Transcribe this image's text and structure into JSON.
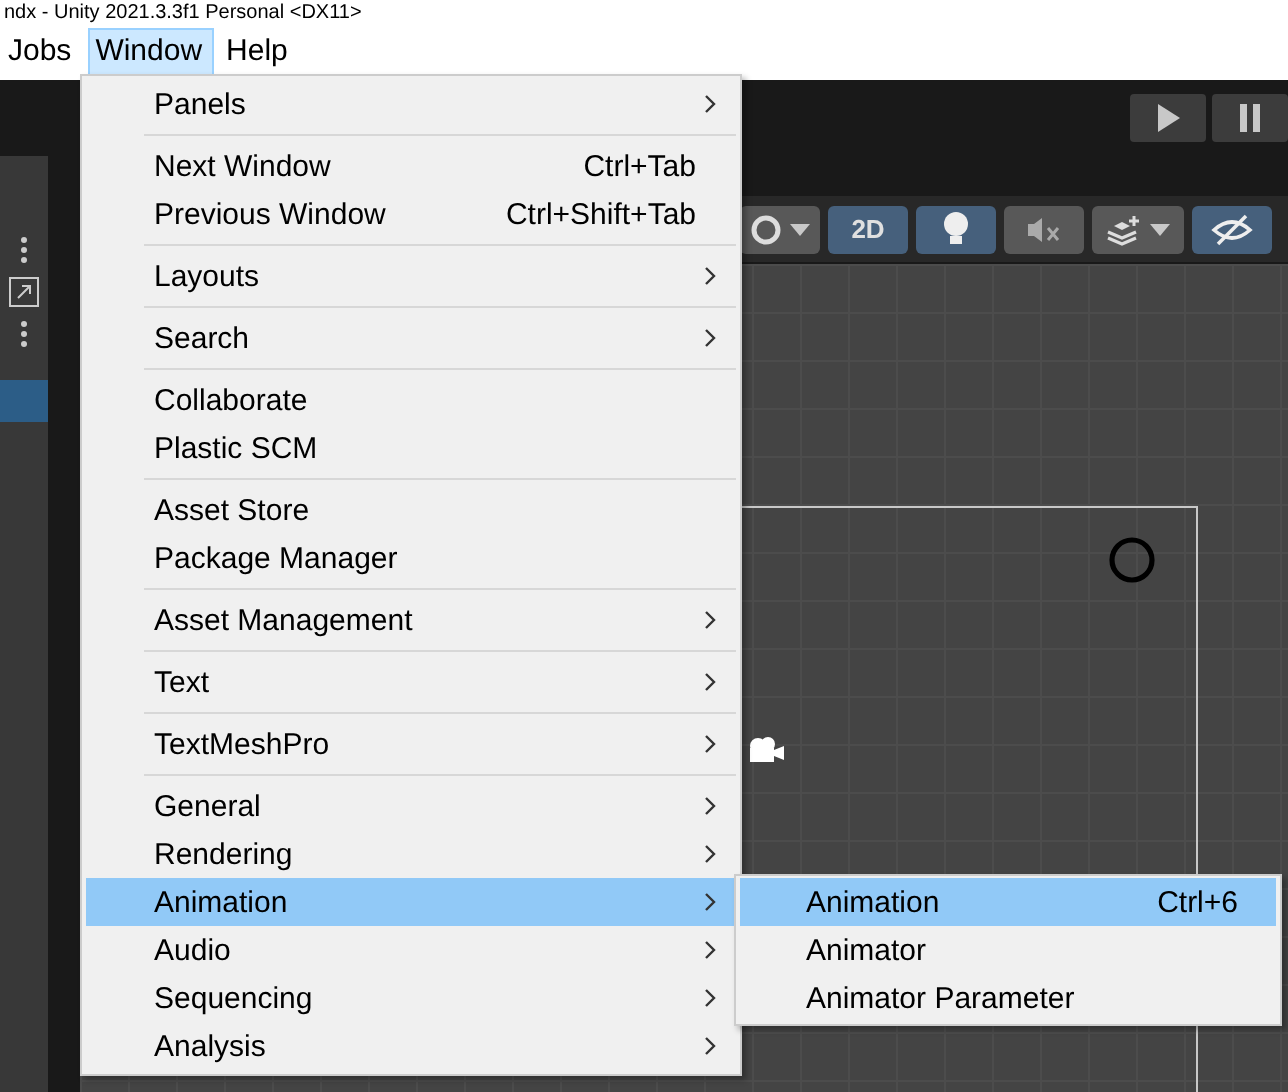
{
  "window": {
    "title": "ndx - Unity 2021.3.3f1 Personal <DX11>"
  },
  "menubar": [
    {
      "label": "Jobs",
      "selected": false
    },
    {
      "label": "Window",
      "selected": true
    },
    {
      "label": "Help",
      "selected": false
    }
  ],
  "scene_toolbar": [
    {
      "kind": "shading",
      "on": false
    },
    {
      "kind": "dimension",
      "label": "2D",
      "on": true
    },
    {
      "kind": "light",
      "on": true
    },
    {
      "kind": "audio",
      "on": false
    },
    {
      "kind": "effects",
      "on": false
    },
    {
      "kind": "visibility",
      "on": true
    }
  ],
  "menu": {
    "sections": [
      {
        "items": [
          {
            "label": "Panels",
            "submenu": true,
            "selected": false
          }
        ]
      },
      {
        "items": [
          {
            "label": "Next Window",
            "shortcut": "Ctrl+Tab",
            "submenu": false,
            "selected": false
          },
          {
            "label": "Previous Window",
            "shortcut": "Ctrl+Shift+Tab",
            "submenu": false,
            "selected": false
          }
        ]
      },
      {
        "items": [
          {
            "label": "Layouts",
            "submenu": true,
            "selected": false
          }
        ]
      },
      {
        "items": [
          {
            "label": "Search",
            "submenu": true,
            "selected": false
          }
        ]
      },
      {
        "items": [
          {
            "label": "Collaborate",
            "submenu": false,
            "selected": false
          },
          {
            "label": "Plastic SCM",
            "submenu": false,
            "selected": false
          }
        ]
      },
      {
        "items": [
          {
            "label": "Asset Store",
            "submenu": false,
            "selected": false
          },
          {
            "label": "Package Manager",
            "submenu": false,
            "selected": false
          }
        ]
      },
      {
        "items": [
          {
            "label": "Asset Management",
            "submenu": true,
            "selected": false
          }
        ]
      },
      {
        "items": [
          {
            "label": "Text",
            "submenu": true,
            "selected": false
          }
        ]
      },
      {
        "items": [
          {
            "label": "TextMeshPro",
            "submenu": true,
            "selected": false
          }
        ]
      },
      {
        "items": [
          {
            "label": "General",
            "submenu": true,
            "selected": false
          },
          {
            "label": "Rendering",
            "submenu": true,
            "selected": false
          },
          {
            "label": "Animation",
            "submenu": true,
            "selected": true
          },
          {
            "label": "Audio",
            "submenu": true,
            "selected": false
          },
          {
            "label": "Sequencing",
            "submenu": true,
            "selected": false
          },
          {
            "label": "Analysis",
            "submenu": true,
            "selected": false
          }
        ]
      }
    ]
  },
  "submenu": {
    "items": [
      {
        "label": "Animation",
        "shortcut": "Ctrl+6",
        "selected": true
      },
      {
        "label": "Animator",
        "selected": false
      },
      {
        "label": "Animator Parameter",
        "selected": false
      }
    ]
  }
}
